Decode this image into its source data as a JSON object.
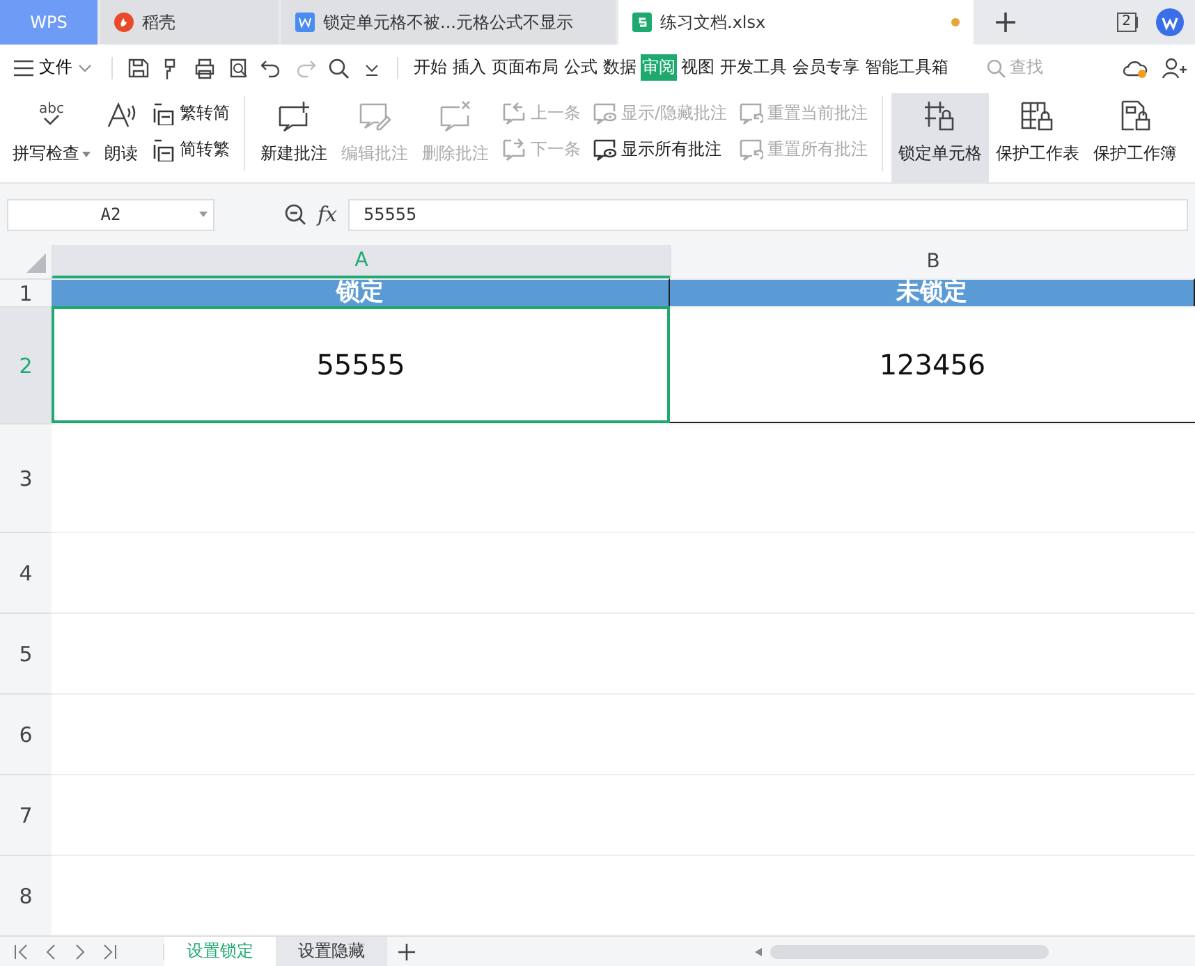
{
  "window_count": "2",
  "title_tabs": [
    {
      "kind": "home",
      "label": "WPS",
      "selected": false
    },
    {
      "kind": "docer",
      "label": "稻壳",
      "selected": false
    },
    {
      "kind": "word",
      "label": "锁定单元格不被...元格公式不显示",
      "selected": false
    },
    {
      "kind": "sheet",
      "label": "练习文档.xlsx",
      "selected": true,
      "unsaved": true
    }
  ],
  "menu": {
    "file": "文件",
    "tabs": [
      {
        "label": "开始",
        "selected": false
      },
      {
        "label": "插入",
        "selected": false
      },
      {
        "label": "页面布局",
        "selected": false
      },
      {
        "label": "公式",
        "selected": false
      },
      {
        "label": "数据",
        "selected": false
      },
      {
        "label": "审阅",
        "selected": true
      },
      {
        "label": "视图",
        "selected": false
      },
      {
        "label": "开发工具",
        "selected": false
      },
      {
        "label": "会员专享",
        "selected": false
      },
      {
        "label": "智能工具箱",
        "selected": false
      }
    ],
    "search": {
      "placeholder": "查找"
    }
  },
  "ribbon": [
    {
      "kind": "big",
      "icon_text": "abc",
      "label": "拼写检查",
      "dropdown": true,
      "disabled": false,
      "selected": false
    },
    {
      "kind": "big",
      "label": "朗读",
      "disabled": false,
      "selected": false
    },
    {
      "kind": "stack",
      "items": [
        {
          "label": "繁转简",
          "disabled": false
        },
        {
          "label": "简转繁",
          "disabled": false
        }
      ]
    },
    {
      "kind": "sep"
    },
    {
      "kind": "big",
      "label": "新建批注",
      "disabled": false,
      "selected": false
    },
    {
      "kind": "big",
      "label": "编辑批注",
      "disabled": true,
      "selected": false
    },
    {
      "kind": "big",
      "label": "删除批注",
      "disabled": true,
      "selected": false
    },
    {
      "kind": "stack",
      "items": [
        {
          "label": "上一条",
          "disabled": true
        },
        {
          "label": "下一条",
          "disabled": true
        }
      ]
    },
    {
      "kind": "stack",
      "items": [
        {
          "label": "显示/隐藏批注",
          "disabled": true
        },
        {
          "label": "显示所有批注",
          "disabled": false
        }
      ]
    },
    {
      "kind": "stack",
      "items": [
        {
          "label": "重置当前批注",
          "disabled": true
        },
        {
          "label": "重置所有批注",
          "disabled": true
        }
      ]
    },
    {
      "kind": "sep"
    },
    {
      "kind": "big",
      "label": "锁定单元格",
      "disabled": false,
      "selected": true
    },
    {
      "kind": "big",
      "label": "保护工作表",
      "disabled": false,
      "selected": false
    },
    {
      "kind": "big",
      "label": "保护工作簿",
      "disabled": false,
      "selected": false
    }
  ],
  "formula_bar": {
    "name_box": "A2",
    "fx": "fx",
    "value": "55555"
  },
  "columns": [
    {
      "label": "A",
      "selected": true
    },
    {
      "label": "B",
      "selected": false
    }
  ],
  "rows": [
    {
      "label": "1",
      "kind": "header",
      "selected": false,
      "cells": [
        "锁定",
        "未锁定"
      ]
    },
    {
      "label": "2",
      "kind": "data",
      "selected": true,
      "cells": [
        "55555",
        "123456"
      ]
    },
    {
      "label": "3",
      "kind": "empty",
      "selected": false,
      "cells": []
    },
    {
      "label": "4",
      "kind": "empty",
      "selected": false,
      "cells": []
    },
    {
      "label": "5",
      "kind": "empty",
      "selected": false,
      "cells": []
    },
    {
      "label": "6",
      "kind": "empty",
      "selected": false,
      "cells": []
    },
    {
      "label": "7",
      "kind": "empty",
      "selected": false,
      "cells": []
    },
    {
      "label": "8",
      "kind": "empty",
      "selected": false,
      "cells": []
    }
  ],
  "sheet_tabs": [
    {
      "label": "设置锁定",
      "selected": true
    },
    {
      "label": "设置隐藏",
      "selected": false
    }
  ]
}
